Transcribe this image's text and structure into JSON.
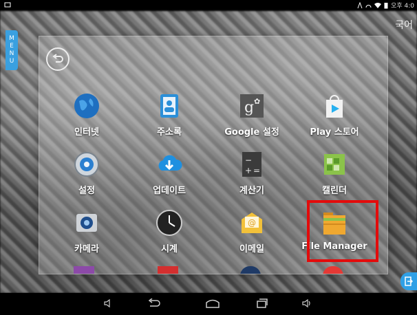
{
  "status_bar": {
    "time": "오후 4:0",
    "icons": [
      "notification-icon",
      "nfc-icon",
      "alarm-icon",
      "wifi-icon",
      "battery-icon"
    ]
  },
  "language_label": "국어",
  "menu_tab": {
    "letters": [
      "M",
      "E",
      "N",
      "U"
    ]
  },
  "drawer": {
    "back_icon": "back-arrow-icon",
    "apps": [
      {
        "label": "인터넷",
        "icon": "globe-icon"
      },
      {
        "label": "주소록",
        "icon": "contacts-icon"
      },
      {
        "label": "Google 설정",
        "icon": "google-settings-icon"
      },
      {
        "label": "Play 스토어",
        "icon": "play-store-icon"
      },
      {
        "label": "설정",
        "icon": "settings-gear-icon"
      },
      {
        "label": "업데이트",
        "icon": "cloud-download-icon"
      },
      {
        "label": "계산기",
        "icon": "calculator-icon"
      },
      {
        "label": "캘린더",
        "icon": "calendar-icon"
      },
      {
        "label": "카메라",
        "icon": "camera-icon"
      },
      {
        "label": "시계",
        "icon": "clock-icon"
      },
      {
        "label": "이메일",
        "icon": "email-icon"
      },
      {
        "label": "File Manager",
        "icon": "folder-icon"
      }
    ],
    "highlighted_app": "File Manager"
  },
  "nav_bar": {
    "items": [
      "volume-down-icon",
      "back-icon",
      "home-icon",
      "recent-apps-icon",
      "volume-up-icon"
    ]
  },
  "colors": {
    "highlight": "#e30b0b",
    "accent": "#3aa0e0"
  }
}
